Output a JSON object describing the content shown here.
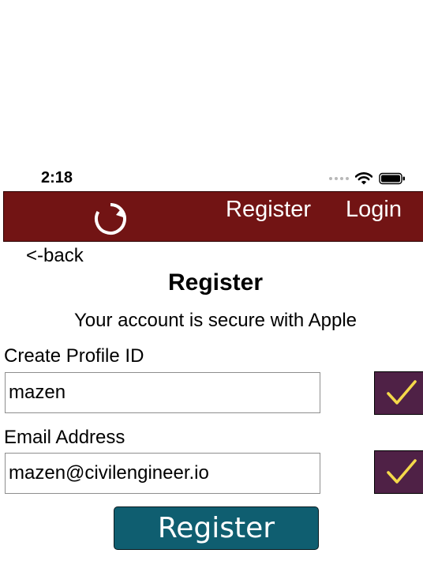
{
  "status_bar": {
    "time": "2:18",
    "icons": [
      "signal-dots-icon",
      "wifi-icon",
      "battery-icon"
    ]
  },
  "navbar": {
    "background_color": "#721414",
    "logo_icon": "refresh-icon",
    "register_label": "Register",
    "login_label": "Login"
  },
  "back_label": "<-back",
  "title": "Register",
  "subtitle": "Your account is secure with Apple",
  "form": {
    "profile": {
      "label": "Create Profile ID",
      "value": "mazen",
      "validated_icon": "checkmark-icon"
    },
    "email": {
      "label": "Email Address",
      "value": "mazen@civilengineer.io",
      "validated_icon": "checkmark-icon"
    },
    "check_color": "#4f2146",
    "checkmark_color": "#f4d94a"
  },
  "submit": {
    "label": "Register",
    "color": "#0f5e70"
  }
}
